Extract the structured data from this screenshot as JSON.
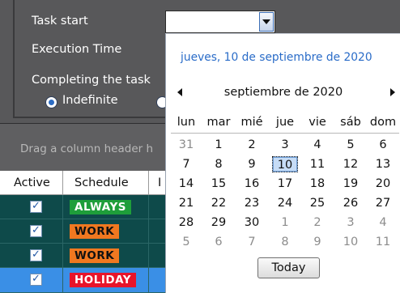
{
  "settings": {
    "task_start_label": "Task start",
    "execution_time_label": "Execution Time",
    "completing_label": "Completing the task",
    "completion_options": [
      {
        "label": "Indefinite",
        "selected": true
      },
      {
        "label": "",
        "selected": false
      }
    ],
    "task_start_value": ""
  },
  "grid": {
    "group_hint": "Drag a column header h",
    "columns": [
      "Active",
      "Schedule",
      "I"
    ],
    "rows": [
      {
        "active": true,
        "checkmark": "✓",
        "schedule": "ALWAYS",
        "schedule_color": "#1e9e3a",
        "schedule_text_color": "#ffffff",
        "col3": "",
        "selected": false
      },
      {
        "active": true,
        "checkmark": "✓",
        "schedule": "WORK",
        "schedule_color": "#f07820",
        "schedule_text_color": "#111111",
        "col3": "",
        "selected": false
      },
      {
        "active": true,
        "checkmark": "✓",
        "schedule": "WORK",
        "schedule_color": "#f07820",
        "schedule_text_color": "#111111",
        "col3": "",
        "selected": false
      },
      {
        "active": true,
        "checkmark": "✓",
        "schedule": "HOLIDAY",
        "schedule_color": "#e8142a",
        "schedule_text_color": "#ffffff",
        "col3": "",
        "selected": true
      }
    ]
  },
  "calendar": {
    "today_text": "jueves, 10 de septiembre de 2020",
    "month_title": "septiembre de 2020",
    "weekdays": [
      "lun",
      "mar",
      "mié",
      "jue",
      "vie",
      "sáb",
      "dom"
    ],
    "weeks": [
      [
        {
          "d": "31",
          "other": true
        },
        {
          "d": "1"
        },
        {
          "d": "2"
        },
        {
          "d": "3"
        },
        {
          "d": "4"
        },
        {
          "d": "5"
        },
        {
          "d": "6"
        }
      ],
      [
        {
          "d": "7"
        },
        {
          "d": "8"
        },
        {
          "d": "9"
        },
        {
          "d": "10",
          "today": true
        },
        {
          "d": "11"
        },
        {
          "d": "12"
        },
        {
          "d": "13"
        }
      ],
      [
        {
          "d": "14"
        },
        {
          "d": "15"
        },
        {
          "d": "16"
        },
        {
          "d": "17"
        },
        {
          "d": "18"
        },
        {
          "d": "19"
        },
        {
          "d": "20"
        }
      ],
      [
        {
          "d": "21"
        },
        {
          "d": "22"
        },
        {
          "d": "23"
        },
        {
          "d": "24"
        },
        {
          "d": "25"
        },
        {
          "d": "26"
        },
        {
          "d": "27"
        }
      ],
      [
        {
          "d": "28"
        },
        {
          "d": "29"
        },
        {
          "d": "30"
        },
        {
          "d": "1",
          "other": true
        },
        {
          "d": "2",
          "other": true
        },
        {
          "d": "3",
          "other": true
        },
        {
          "d": "4",
          "other": true
        }
      ],
      [
        {
          "d": "5",
          "other": true
        },
        {
          "d": "6",
          "other": true
        },
        {
          "d": "7",
          "other": true
        },
        {
          "d": "8",
          "other": true
        },
        {
          "d": "9",
          "other": true
        },
        {
          "d": "10",
          "other": true
        },
        {
          "d": "11",
          "other": true
        }
      ]
    ],
    "today_button_label": "Today"
  },
  "icons": {
    "dropdown": "chevron-down-icon",
    "prev_month": "arrow-left-icon",
    "next_month": "arrow-right-icon",
    "checkbox": "check-icon"
  }
}
